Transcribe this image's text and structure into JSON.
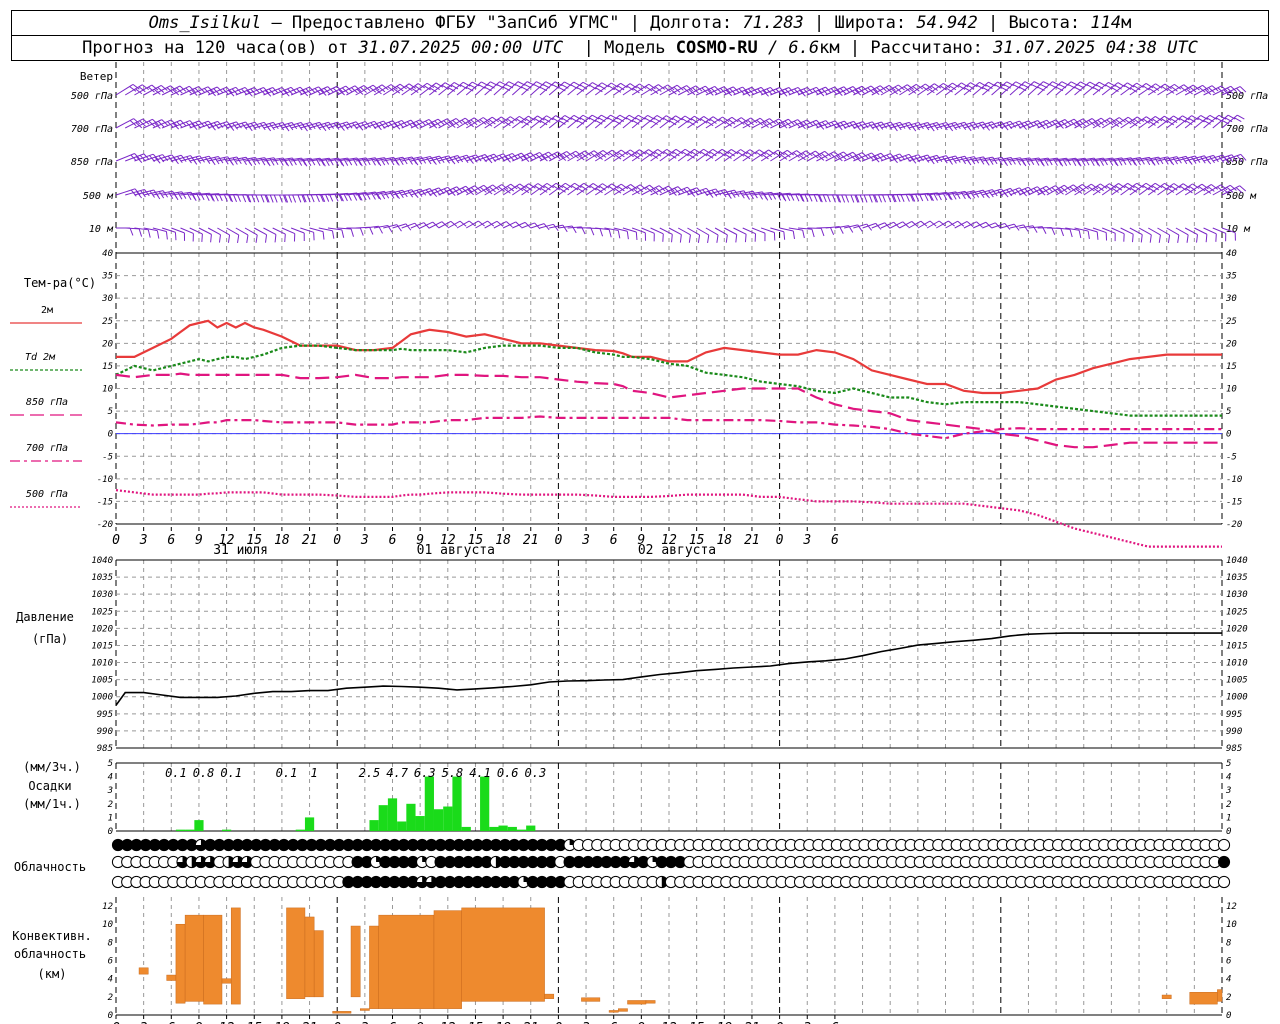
{
  "header": {
    "station": "Oms_Isilkul",
    "provider": "– Предоставлено ФГБУ \"ЗапСиб УГМС\"",
    "lon_label": "| Долгота:",
    "lon": "71.283",
    "lat_label": "| Широта:",
    "lat": "54.942",
    "alt_label": "| Высота:",
    "alt": "114",
    "alt_unit": "м",
    "forecast_label": "Прогноз на 120 часа(ов) от",
    "forecast_start": "31.07.2025 00:00 UTC",
    "model_label": "| Модель",
    "model": "COSMO-RU",
    "resolution": "/ 6.6",
    "res_unit": "км",
    "calc_label": "| Рассчитано:",
    "calc_time": "31.07.2025 04:38 UTC"
  },
  "labels": {
    "wind_title": "Ветер",
    "wind_levels": [
      "500 гПа",
      "700 гПа",
      "850 гПа",
      "500 м",
      "10  м"
    ],
    "temp_title": "Тем-ра(°С)",
    "temp_legend": [
      {
        "label": "2м",
        "color": "#e83a3a",
        "dash": ""
      },
      {
        "label": "Td  2м",
        "color": "#1a8a1a",
        "dash": "3,2"
      },
      {
        "label": "850 гПа",
        "color": "#e0157f",
        "dash": "14,6"
      },
      {
        "label": "700 гПа",
        "color": "#e0157f",
        "dash": "10,4,3,4"
      },
      {
        "label": "500 гПа",
        "color": "#e0157f",
        "dash": "2,2"
      }
    ],
    "pressure_title_1": "Давление",
    "pressure_title_2": "(гПа)",
    "precip_title_1": "(мм/3ч.)",
    "precip_title_2": "Осадки",
    "precip_title_3": "(мм/1ч.)",
    "cloud_title": "Облачность",
    "conv_title_1": "Конвективн.",
    "conv_title_2": "облачность",
    "conv_title_3": "(км)",
    "days": [
      "31 июля",
      "01 августа",
      "02 августа"
    ]
  },
  "chart_data": [
    {
      "type": "line",
      "name": "temperature",
      "x_hours": [
        0,
        2,
        4,
        6,
        7,
        8,
        9,
        10,
        11,
        12,
        13,
        14,
        15,
        16,
        18,
        20,
        22,
        24,
        26,
        28,
        30,
        31,
        32,
        33,
        34,
        36,
        38,
        40,
        42,
        44,
        46,
        48,
        50,
        52,
        54,
        55,
        56,
        58,
        60,
        62,
        64,
        66,
        68,
        70,
        72,
        74,
        76,
        78,
        80,
        82,
        84,
        86,
        88,
        90,
        92,
        94,
        96,
        98,
        100,
        102,
        104,
        106,
        108,
        110,
        112,
        114,
        115,
        116,
        117,
        118,
        120
      ],
      "series": [
        {
          "name": "2м",
          "color": "#e83a3a",
          "dash": "",
          "values": [
            17,
            17,
            19,
            21,
            22.5,
            24,
            24.5,
            25,
            23.5,
            24.5,
            23.5,
            24.5,
            23.5,
            23,
            21.5,
            19.5,
            19.5,
            19.5,
            18.5,
            18.5,
            19,
            20.5,
            22,
            22.5,
            23,
            22.5,
            21.5,
            22,
            21,
            20,
            20,
            19.5,
            19,
            18.5,
            18.3,
            17.8,
            17,
            17,
            16,
            16,
            18,
            19,
            18.5,
            18,
            17.5,
            17.5,
            18.5,
            18,
            16.5,
            14,
            13,
            12,
            11,
            11,
            9.5,
            9,
            9,
            9.5,
            10,
            12,
            13,
            14.5,
            15.5,
            16.5,
            17,
            17.5,
            17.5,
            17.5,
            17.5,
            17.5,
            17.5
          ]
        },
        {
          "name": "Td  2м",
          "color": "#1a8a1a",
          "dash": "3,2",
          "values": [
            13,
            15,
            14,
            15,
            15.5,
            16,
            16.5,
            16,
            16.5,
            17,
            17,
            16.5,
            17,
            17.5,
            19,
            19.5,
            19.5,
            19,
            18.5,
            18.5,
            18.5,
            18.8,
            18.5,
            18.5,
            18.5,
            18.5,
            18,
            19,
            19.5,
            19.5,
            19.5,
            19,
            19,
            18,
            17.5,
            17,
            17,
            16.5,
            15.5,
            15,
            13.5,
            13,
            12.5,
            11.5,
            11,
            10.5,
            9.5,
            9,
            10,
            9,
            8,
            8,
            7,
            6.5,
            7,
            7,
            7,
            7,
            6.5,
            6,
            5.5,
            5,
            4.5,
            4,
            4,
            4,
            4,
            4,
            4,
            4,
            4
          ]
        },
        {
          "name": "850 гПа",
          "color": "#e0157f",
          "dash": "14,6",
          "values": [
            13,
            12.5,
            13,
            13,
            13.3,
            13,
            13,
            13,
            13,
            13,
            13,
            13,
            13,
            13,
            13,
            12.3,
            12.3,
            12.5,
            13,
            12.3,
            12.3,
            12.5,
            12.5,
            12.5,
            12.5,
            13,
            13,
            12.8,
            12.8,
            12.5,
            12.5,
            12,
            11.5,
            11.2,
            11,
            10.5,
            9.5,
            9,
            8,
            8.5,
            9,
            9.5,
            10,
            10,
            10,
            10,
            8,
            6.5,
            5.5,
            5,
            4.5,
            3,
            2.5,
            2,
            1.5,
            1,
            0,
            -0.5,
            -1.5,
            -2.5,
            -3,
            -3,
            -2.5,
            -2,
            -2,
            -2,
            -2,
            -2,
            -2,
            -2,
            -2
          ]
        },
        {
          "name": "700 гПа",
          "color": "#e0157f",
          "dash": "10,4,3,4",
          "values": [
            2.5,
            2,
            1.8,
            2,
            2,
            2,
            2.2,
            2.5,
            2.5,
            3,
            3,
            3,
            3,
            2.8,
            2.5,
            2.5,
            2.5,
            2.5,
            2,
            2,
            2,
            2.5,
            2.5,
            2.5,
            2.5,
            3,
            3,
            3.5,
            3.5,
            3.5,
            3.8,
            3.5,
            3.5,
            3.5,
            3.5,
            3.5,
            3.5,
            3.5,
            3.5,
            3,
            3,
            3,
            3,
            3,
            2.8,
            2.5,
            2.5,
            2,
            1.8,
            1.5,
            1,
            0,
            -0.5,
            -1,
            0,
            0.5,
            1,
            1.2,
            1,
            1,
            1,
            1,
            1,
            1,
            1,
            1,
            1,
            1,
            1,
            1,
            1
          ]
        },
        {
          "name": "500 гПа",
          "color": "#e0157f",
          "dash": "2,2",
          "values": [
            -12.5,
            -13,
            -13.5,
            -13.5,
            -13.5,
            -13.5,
            -13.5,
            -13.3,
            -13.2,
            -13,
            -13,
            -13,
            -13,
            -13,
            -13.5,
            -13.5,
            -13.5,
            -13.7,
            -14,
            -14,
            -14,
            -13.7,
            -13.5,
            -13.5,
            -13.3,
            -13,
            -13,
            -13,
            -13.3,
            -13.5,
            -13.5,
            -13.5,
            -13.5,
            -13.7,
            -14,
            -14,
            -14,
            -14,
            -13.8,
            -13.5,
            -13.5,
            -13.5,
            -13.5,
            -14,
            -14,
            -14.5,
            -15,
            -15,
            -15,
            -15.2,
            -15.5,
            -15.5,
            -15.5,
            -15.5,
            -15.5,
            -16,
            -16.5,
            -17,
            -18,
            -19.5,
            -21,
            -22,
            -23,
            -24,
            -25,
            -25,
            -25,
            -25,
            -25,
            -25,
            -25
          ]
        }
      ],
      "ylim": [
        -20,
        40
      ],
      "yticks": [
        -20,
        -15,
        -10,
        -5,
        0,
        5,
        10,
        15,
        20,
        25,
        30,
        35,
        40
      ],
      "zero_line_color": "#3a3aff"
    },
    {
      "type": "line",
      "name": "pressure",
      "x_hours": [
        0,
        1,
        3,
        5,
        7,
        9,
        11,
        13,
        15,
        17,
        19,
        21,
        23,
        25,
        27,
        29,
        31,
        33,
        35,
        37,
        39,
        41,
        43,
        45,
        47,
        49,
        51,
        53,
        55,
        57,
        59,
        61,
        63,
        65,
        67,
        69,
        71,
        73,
        75,
        77,
        79,
        81,
        83,
        85,
        87,
        89,
        91,
        93,
        95,
        97,
        99,
        101,
        103,
        105,
        107,
        109,
        111,
        113,
        115,
        117,
        119,
        120
      ],
      "series": [
        {
          "name": "Давление",
          "color": "#000000",
          "values": [
            997.5,
            1001.2,
            1001.2,
            1000.5,
            999.8,
            999.8,
            999.8,
            1000.2,
            1001,
            1001.5,
            1001.5,
            1001.8,
            1001.8,
            1002.5,
            1002.8,
            1003.1,
            1003,
            1002.8,
            1002.5,
            1002,
            1002.3,
            1002.6,
            1003,
            1003.5,
            1004.3,
            1004.6,
            1004.7,
            1004.9,
            1005,
            1005.8,
            1006.5,
            1007,
            1007.6,
            1008,
            1008.4,
            1008.7,
            1009,
            1009.7,
            1010.2,
            1010.5,
            1011,
            1012,
            1013.2,
            1014.1,
            1015.1,
            1015.6,
            1016.1,
            1016.5,
            1017,
            1017.8,
            1018.3,
            1018.5,
            1018.6,
            1018.6,
            1018.6,
            1018.6,
            1018.6,
            1018.6,
            1018.6,
            1018.6,
            1018.6,
            1018.6
          ]
        }
      ],
      "ylim": [
        985,
        1040
      ],
      "yticks": [
        985,
        990,
        995,
        1000,
        1005,
        1010,
        1015,
        1020,
        1025,
        1030,
        1035,
        1040
      ]
    },
    {
      "type": "bar",
      "name": "precipitation",
      "color": "#1adb1a",
      "hourly": [
        {
          "x": 7,
          "v": 0.1
        },
        {
          "x": 8,
          "v": 0.1
        },
        {
          "x": 9,
          "v": 0.8
        },
        {
          "x": 12,
          "v": 0.1
        },
        {
          "x": 20,
          "v": 0.1
        },
        {
          "x": 21,
          "v": 1.0
        },
        {
          "x": 28,
          "v": 0.8
        },
        {
          "x": 29,
          "v": 1.9
        },
        {
          "x": 30,
          "v": 2.4
        },
        {
          "x": 31,
          "v": 0.7
        },
        {
          "x": 32,
          "v": 2.0
        },
        {
          "x": 33,
          "v": 1.1
        },
        {
          "x": 34,
          "v": 4.0
        },
        {
          "x": 35,
          "v": 1.6
        },
        {
          "x": 36,
          "v": 1.8
        },
        {
          "x": 37,
          "v": 4.0
        },
        {
          "x": 38,
          "v": 0.3
        },
        {
          "x": 40,
          "v": 4.0
        },
        {
          "x": 41,
          "v": 0.3
        },
        {
          "x": 42,
          "v": 0.4
        },
        {
          "x": 43,
          "v": 0.3
        },
        {
          "x": 44,
          "v": 0.1
        },
        {
          "x": 45,
          "v": 0.4
        }
      ],
      "totals_3h": [
        {
          "x": 7.5,
          "label": "0.1"
        },
        {
          "x": 10.5,
          "label": "0.8"
        },
        {
          "x": 13.5,
          "label": "0.1"
        },
        {
          "x": 19.5,
          "label": "0.1"
        },
        {
          "x": 22.5,
          "label": "1"
        },
        {
          "x": 28.5,
          "label": "2.5"
        },
        {
          "x": 31.5,
          "label": "4.7"
        },
        {
          "x": 34.5,
          "label": "6.3"
        },
        {
          "x": 37.5,
          "label": "5.8"
        },
        {
          "x": 40.5,
          "label": "4.1"
        },
        {
          "x": 43.5,
          "label": "0.6"
        },
        {
          "x": 46.5,
          "label": "0.3"
        }
      ],
      "ylim": [
        0,
        5
      ],
      "yticks": [
        0,
        1,
        2,
        3,
        4,
        5
      ]
    },
    {
      "type": "table",
      "name": "cloudiness",
      "note": "octa fraction 0..4 (0 clear, 4 overcast) per hour, rows: top / middle / low",
      "rows": [
        "4444444443444444444444444444444444444444444444444100000000000000000000000000000000000000000000000000000000000000000000000",
        "0000000323302330000000000044144441044444424444440444444434144400000000000000000000000000000000000000000000000000000000004",
        "0000000000000000000000000444444443344444444414444000000000020000000000000000000000000000000000000000000000000000000000000"
      ]
    },
    {
      "type": "bar",
      "name": "convective clouds",
      "color": "#ee8a2e",
      "segments": [
        {
          "x0": 2.5,
          "x1": 3.5,
          "b": 4.5,
          "t": 5.2
        },
        {
          "x0": 5.5,
          "x1": 6.5,
          "b": 3.8,
          "t": 4.4
        },
        {
          "x0": 6.5,
          "x1": 7.5,
          "b": 1.3,
          "t": 10
        },
        {
          "x0": 7.5,
          "x1": 9.5,
          "b": 1.5,
          "t": 11
        },
        {
          "x0": 9.5,
          "x1": 11.5,
          "b": 1.2,
          "t": 11
        },
        {
          "x0": 11.5,
          "x1": 12.5,
          "b": 3.5,
          "t": 4
        },
        {
          "x0": 12.5,
          "x1": 13.5,
          "b": 1.2,
          "t": 11.8
        },
        {
          "x0": 18.5,
          "x1": 20.5,
          "b": 1.8,
          "t": 11.8
        },
        {
          "x0": 20.5,
          "x1": 21.5,
          "b": 2,
          "t": 10.8
        },
        {
          "x0": 21.5,
          "x1": 22.5,
          "b": 2,
          "t": 9.3
        },
        {
          "x0": 23.5,
          "x1": 25.5,
          "b": 0.2,
          "t": 0.4
        },
        {
          "x0": 25.5,
          "x1": 26.5,
          "b": 2,
          "t": 9.8
        },
        {
          "x0": 26.5,
          "x1": 27.5,
          "b": 0.5,
          "t": 0.7
        },
        {
          "x0": 27.5,
          "x1": 28.5,
          "b": 0.7,
          "t": 9.8
        },
        {
          "x0": 28.5,
          "x1": 34.5,
          "b": 0.7,
          "t": 11
        },
        {
          "x0": 34.5,
          "x1": 37.5,
          "b": 0.7,
          "t": 11.5
        },
        {
          "x0": 37.5,
          "x1": 46.5,
          "b": 1.5,
          "t": 11.8
        },
        {
          "x0": 46.5,
          "x1": 47.5,
          "b": 1.8,
          "t": 2.3
        },
        {
          "x0": 50.5,
          "x1": 52.5,
          "b": 1.5,
          "t": 1.9
        },
        {
          "x0": 53.5,
          "x1": 54.5,
          "b": 0.3,
          "t": 0.5
        },
        {
          "x0": 54.5,
          "x1": 55.5,
          "b": 0.4,
          "t": 0.7
        },
        {
          "x0": 55.5,
          "x1": 57.5,
          "b": 1.2,
          "t": 1.6
        },
        {
          "x0": 57.5,
          "x1": 58.5,
          "b": 1.3,
          "t": 1.6
        },
        {
          "x0": 113.5,
          "x1": 114.5,
          "b": 1.8,
          "t": 2.2
        },
        {
          "x0": 116.5,
          "x1": 119.5,
          "b": 1.2,
          "t": 2.5
        },
        {
          "x0": 119.5,
          "x1": 120,
          "b": 1.5,
          "t": 2.8
        }
      ],
      "ylim": [
        0,
        13
      ],
      "yticks": [
        0,
        2,
        4,
        6,
        8,
        10,
        12
      ]
    }
  ],
  "wind": {
    "color": "#7a27c8",
    "note": "wind barbs every hour at 5 levels; barb flags not transcribed numerically"
  },
  "x_axis": {
    "hours_total": 120,
    "tick_labels": [
      "0",
      "3",
      "6",
      "9",
      "12",
      "15",
      "18",
      "21",
      "0",
      "3",
      "6",
      "9",
      "12",
      "15",
      "18",
      "21",
      "0",
      "3",
      "6",
      "9",
      "12",
      "15",
      "18",
      "21",
      "0",
      "3",
      "6"
    ],
    "midnights": [
      0,
      24,
      48,
      72,
      96
    ]
  }
}
